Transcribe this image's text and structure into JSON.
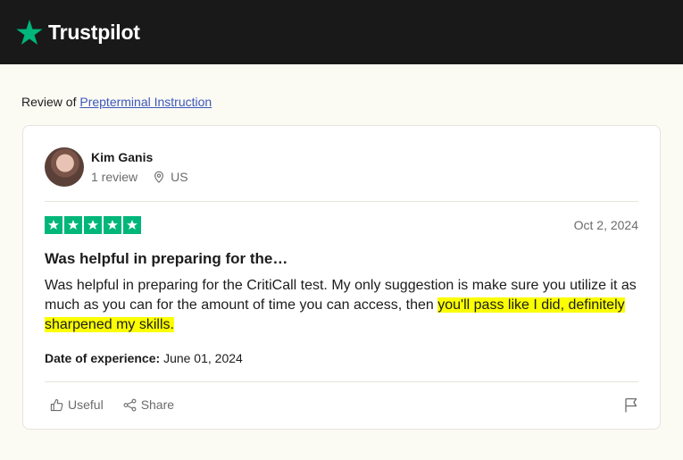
{
  "header": {
    "brand": "Trustpilot",
    "brand_color": "#00b67a"
  },
  "review_of": {
    "prefix": "Review of",
    "company": "Prepterminal Instruction"
  },
  "reviewer": {
    "name": "Kim Ganis",
    "review_count": "1 review",
    "country": "US"
  },
  "review": {
    "rating": 5,
    "rating_max": 5,
    "date": "Oct 2, 2024",
    "title": "Was helpful in preparing for the…",
    "body_plain": "Was helpful in preparing for the CritiCall test. My only suggestion is make sure you utilize it as much as you can for the amount of time you can access, then ",
    "body_highlight": "you'll pass like I did, definitely sharpened my skills.",
    "highlight_color": "#fbff00",
    "experience_label": "Date of experience:",
    "experience_date": "June 01, 2024"
  },
  "actions": {
    "useful": "Useful",
    "share": "Share"
  }
}
